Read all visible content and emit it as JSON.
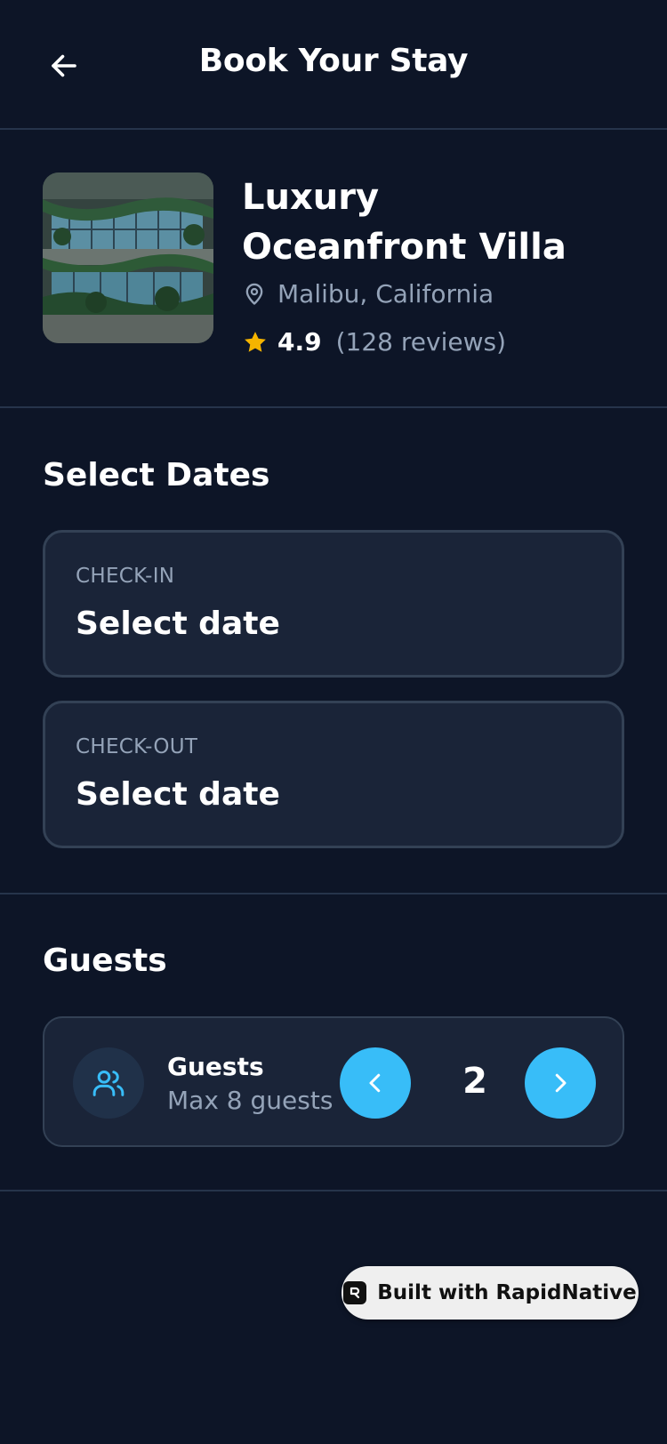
{
  "header": {
    "title": "Book Your Stay",
    "back_icon": "arrow-left-icon"
  },
  "property": {
    "name": "Luxury Oceanfront Villa",
    "location": "Malibu, California",
    "rating": "4.9",
    "reviews": "(128 reviews)",
    "star_color": "#f5b400"
  },
  "dates": {
    "section_title": "Select Dates",
    "check_in": {
      "label": "CHECK-IN",
      "value": "Select date"
    },
    "check_out": {
      "label": "CHECK-OUT",
      "value": "Select date"
    }
  },
  "guests": {
    "section_title": "Guests",
    "title": "Guests",
    "subtitle": "Max 8 guests",
    "count": "2",
    "accent_color": "#38bdf8"
  },
  "badge": {
    "label": "Built with RapidNative"
  }
}
